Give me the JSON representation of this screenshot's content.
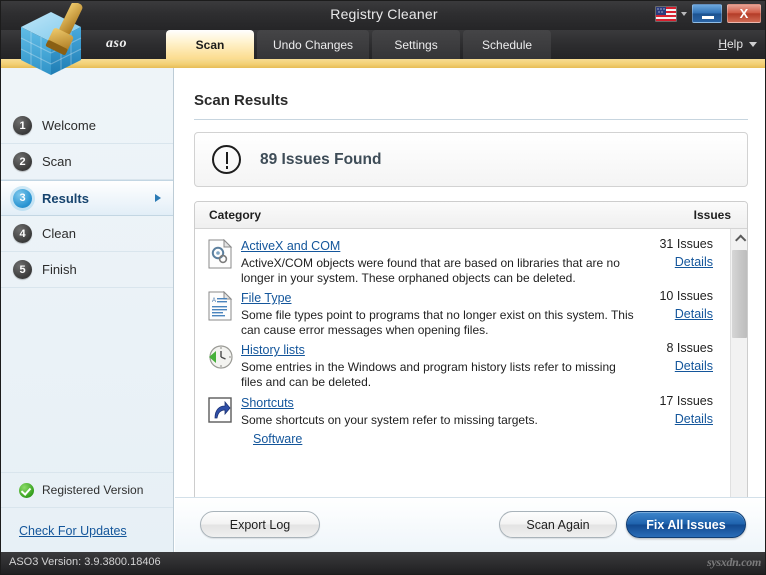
{
  "window": {
    "title": "Registry Cleaner",
    "minimize_label": "",
    "close_label": "X",
    "language_icon": "us-flag-icon"
  },
  "tabbar": {
    "brand": "aso",
    "tabs": [
      {
        "label": "Scan",
        "active": true
      },
      {
        "label": "Undo Changes",
        "active": false
      },
      {
        "label": "Settings",
        "active": false
      },
      {
        "label": "Schedule",
        "active": false
      }
    ],
    "help_label": "Help"
  },
  "sidebar": {
    "items": [
      {
        "number": "1",
        "label": "Welcome",
        "active": false
      },
      {
        "number": "2",
        "label": "Scan",
        "active": false
      },
      {
        "number": "3",
        "label": "Results",
        "active": true
      },
      {
        "number": "4",
        "label": "Clean",
        "active": false
      },
      {
        "number": "5",
        "label": "Finish",
        "active": false
      }
    ],
    "registered_label": "Registered Version",
    "updates_label": "Check For Updates"
  },
  "main": {
    "page_title": "Scan Results",
    "summary": "89 Issues Found",
    "columns": {
      "category": "Category",
      "issues": "Issues"
    },
    "rows": [
      {
        "name": "ActiveX and COM",
        "description": "ActiveX/COM objects were found that are based on libraries that are no longer in your system. These orphaned objects can be deleted.",
        "count": "31 Issues",
        "details": "Details",
        "icon": "activex-com-icon"
      },
      {
        "name": "File Type",
        "description": "Some file types point to programs that no longer exist on this system. This can cause error messages when opening files.",
        "count": "10 Issues",
        "details": "Details",
        "icon": "file-type-icon"
      },
      {
        "name": "History lists",
        "description": "Some entries in the Windows and program history lists refer to missing files and can be deleted.",
        "count": "8 Issues",
        "details": "Details",
        "icon": "history-lists-icon"
      },
      {
        "name": "Shortcuts",
        "description": "Some shortcuts on your system refer to missing targets.",
        "count": "17 Issues",
        "details": "Details",
        "icon": "shortcuts-icon"
      }
    ],
    "partial_row": {
      "name": "Software"
    }
  },
  "footer": {
    "export_label": "Export Log",
    "scan_again_label": "Scan Again",
    "fix_all_label": "Fix All Issues"
  },
  "statusbar": {
    "version": "ASO3 Version: 3.9.3800.18406",
    "watermark": "sysxdn.com"
  },
  "colors": {
    "accent_blue": "#1f62ad",
    "link_blue": "#14569b",
    "tab_active": "#fbdc8e",
    "sidebar_bg": "#e7f0f6"
  }
}
